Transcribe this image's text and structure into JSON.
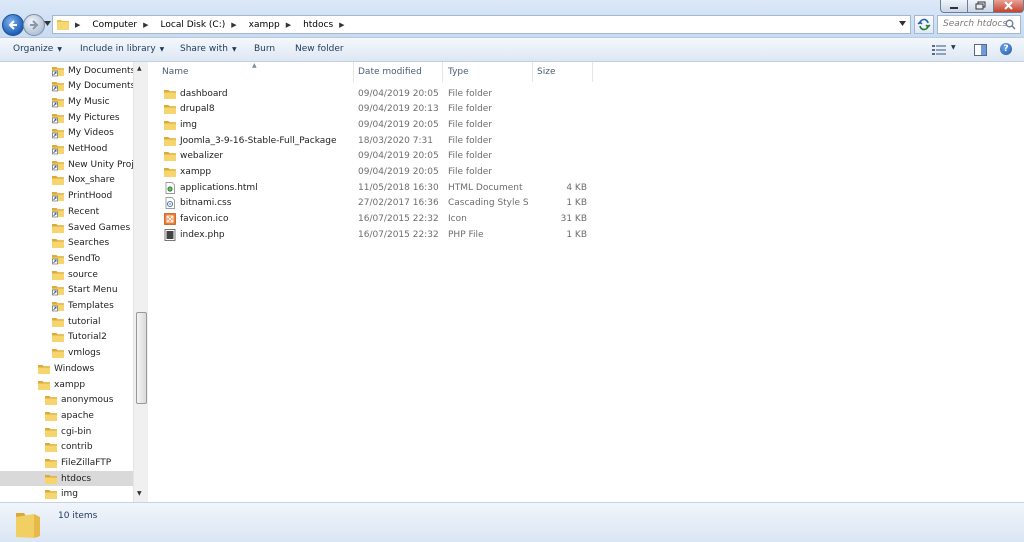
{
  "address": {
    "crumbs": [
      "Computer",
      "Local Disk (C:)",
      "xampp",
      "htdocs"
    ],
    "search_placeholder": "Search htdocs"
  },
  "toolbar": {
    "organize": "Organize",
    "include_in_library": "Include in library",
    "share_with": "Share with",
    "burn": "Burn",
    "new_folder": "New folder"
  },
  "nav": {
    "items": [
      {
        "label": "My Documents",
        "icon": "doc-folder-icon"
      },
      {
        "label": "My Documents",
        "icon": "shortcut-folder-icon"
      },
      {
        "label": "My Music",
        "icon": "shortcut-folder-icon"
      },
      {
        "label": "My Pictures",
        "icon": "shortcut-folder-icon"
      },
      {
        "label": "My Videos",
        "icon": "shortcut-folder-icon"
      },
      {
        "label": "NetHood",
        "icon": "shortcut-folder-icon"
      },
      {
        "label": "New Unity Project",
        "icon": "shortcut-folder-icon"
      },
      {
        "label": "Nox_share",
        "icon": "folder-icon"
      },
      {
        "label": "PrintHood",
        "icon": "shortcut-folder-icon"
      },
      {
        "label": "Recent",
        "icon": "shortcut-folder-icon"
      },
      {
        "label": "Saved Games",
        "icon": "folder-icon"
      },
      {
        "label": "Searches",
        "icon": "folder-icon"
      },
      {
        "label": "SendTo",
        "icon": "shortcut-folder-icon"
      },
      {
        "label": "source",
        "icon": "folder-icon"
      },
      {
        "label": "Start Menu",
        "icon": "shortcut-folder-icon"
      },
      {
        "label": "Templates",
        "icon": "shortcut-folder-icon"
      },
      {
        "label": "tutorial",
        "icon": "folder-icon"
      },
      {
        "label": "Tutorial2",
        "icon": "folder-icon"
      },
      {
        "label": "vmlogs",
        "icon": "folder-icon"
      },
      {
        "label": "Windows",
        "icon": "folder-icon"
      },
      {
        "label": "xampp",
        "icon": "folder-icon"
      },
      {
        "label": "anonymous",
        "icon": "folder-icon"
      },
      {
        "label": "apache",
        "icon": "folder-icon"
      },
      {
        "label": "cgi-bin",
        "icon": "folder-icon"
      },
      {
        "label": "contrib",
        "icon": "folder-icon"
      },
      {
        "label": "FileZillaFTP",
        "icon": "folder-icon"
      },
      {
        "label": "htdocs",
        "icon": "folder-icon",
        "selected": true
      },
      {
        "label": "img",
        "icon": "folder-icon"
      }
    ]
  },
  "columns": {
    "name": "Name",
    "date": "Date modified",
    "type": "Type",
    "size": "Size"
  },
  "files": [
    {
      "name": "dashboard",
      "date": "09/04/2019 20:05",
      "type": "File folder",
      "size": "",
      "icon": "folder-icon"
    },
    {
      "name": "drupal8",
      "date": "09/04/2019 20:13",
      "type": "File folder",
      "size": "",
      "icon": "folder-icon"
    },
    {
      "name": "img",
      "date": "09/04/2019 20:05",
      "type": "File folder",
      "size": "",
      "icon": "folder-icon"
    },
    {
      "name": "Joomla_3-9-16-Stable-Full_Package",
      "date": "18/03/2020 7:31",
      "type": "File folder",
      "size": "",
      "icon": "folder-icon"
    },
    {
      "name": "webalizer",
      "date": "09/04/2019 20:05",
      "type": "File folder",
      "size": "",
      "icon": "folder-icon"
    },
    {
      "name": "xampp",
      "date": "09/04/2019 20:05",
      "type": "File folder",
      "size": "",
      "icon": "folder-icon"
    },
    {
      "name": "applications.html",
      "date": "11/05/2018 16:30",
      "type": "HTML Document",
      "size": "4 KB",
      "icon": "html-file-icon"
    },
    {
      "name": "bitnami.css",
      "date": "27/02/2017 16:36",
      "type": "Cascading Style S...",
      "size": "1 KB",
      "icon": "css-file-icon"
    },
    {
      "name": "favicon.ico",
      "date": "16/07/2015 22:32",
      "type": "Icon",
      "size": "31 KB",
      "icon": "ico-file-icon"
    },
    {
      "name": "index.php",
      "date": "16/07/2015 22:32",
      "type": "PHP File",
      "size": "1 KB",
      "icon": "php-file-icon"
    }
  ],
  "status": {
    "count": "10 items"
  }
}
